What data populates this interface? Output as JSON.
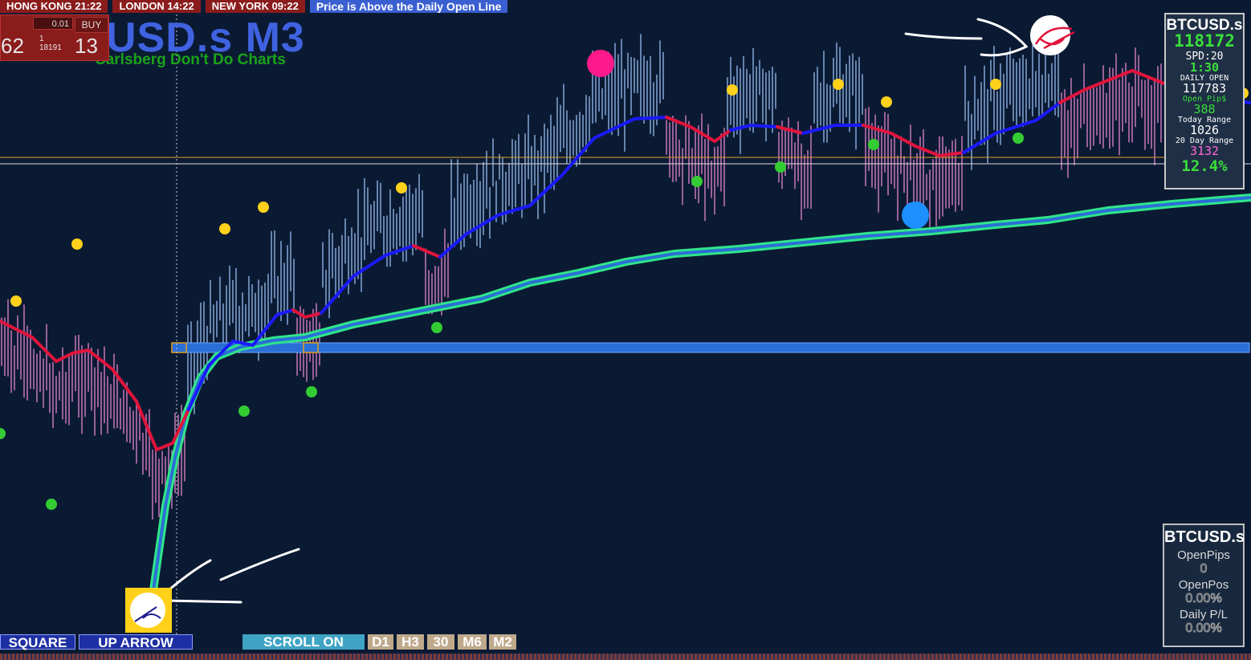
{
  "sessions": [
    {
      "label": "HONG KONG 21:22"
    },
    {
      "label": "LONDON  14:22"
    },
    {
      "label": "NEW YORK 09:22"
    }
  ],
  "status_message": "Price is Above the Daily Open Line",
  "trade_panel": {
    "lot_size": "0.01",
    "buy_label": "BUY",
    "bid_big": "62",
    "price_prefix_top": "1",
    "price_prefix_bottom": "18191",
    "ask_big": "13"
  },
  "chart_title": "USD.s M3",
  "tagline": "Carlsberg Don't Do Charts",
  "info_panel": {
    "symbol": "BTCUSD.s",
    "price": "118172",
    "spread": "SPD:20",
    "countdown": "1:30",
    "daily_open_label": "DAILY OPEN",
    "daily_open": "117783",
    "open_pips_label": "Open Pip$",
    "open_pips": "388",
    "today_range_label": "Today Range",
    "today_range": "1026",
    "day20_range_label": "20 Day Range",
    "day20_range": "3132",
    "range_pct": "12.4%"
  },
  "position_panel": {
    "symbol": "BTCUSD.s",
    "open_pips_label": "OpenPips",
    "open_pips": "0",
    "open_pos_label": "OpenPos",
    "open_pos": "0.00%",
    "daily_pl_label": "Daily P/L",
    "daily_pl": "0.00%"
  },
  "bottom_buttons": {
    "square": "SQUARE",
    "up_arrow": "UP ARROW",
    "scroll": "SCROLL ON",
    "tf": [
      "D1",
      "H3",
      "30",
      "M6",
      "M2"
    ]
  },
  "colors": {
    "background": "#0b1a33",
    "bull_candle": "#8fb7e8",
    "bear_candle": "#d982c9",
    "ma_up": "#1a1aff",
    "ma_down": "#e0143c",
    "slow_ma": "#2fe68a",
    "daily_open_band": "#2a6fd6",
    "peak_dot": "#ffd11a",
    "trough_dot": "#33cc33",
    "price_line": "#e0a020"
  },
  "icons": [
    "pink-marker-icon",
    "blue-marker-icon",
    "hand-drawn-arrow-icon",
    "up-arrow-signal-icon"
  ]
}
